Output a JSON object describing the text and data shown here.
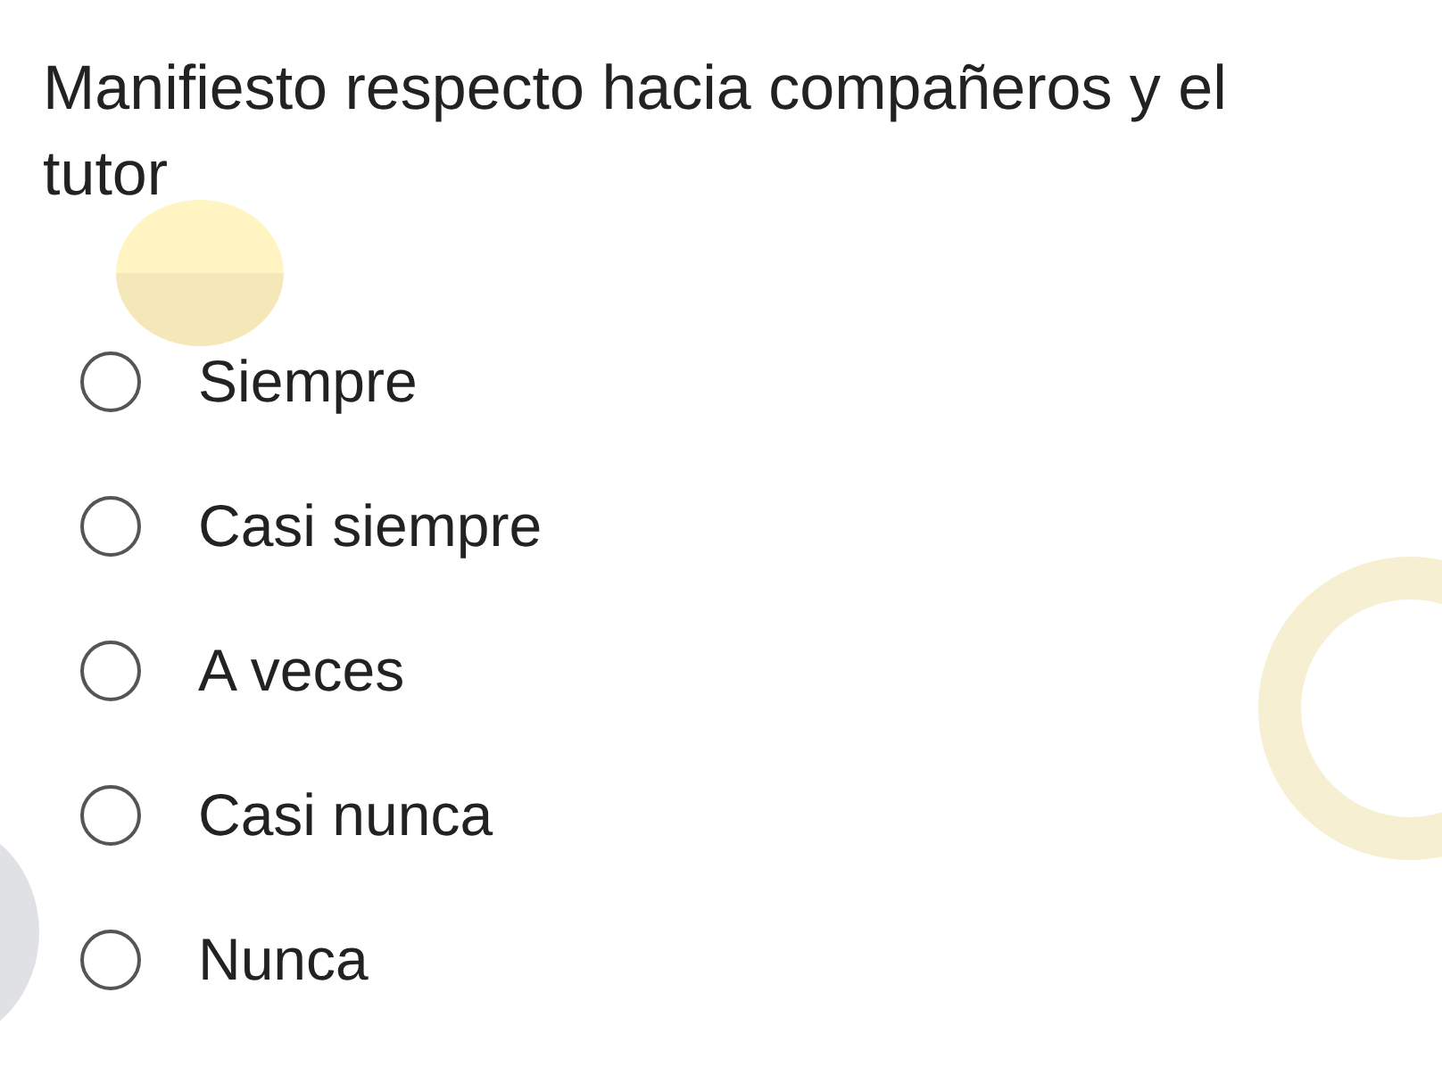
{
  "question": {
    "title": "Manifiesto respecto hacia compañeros y el tutor"
  },
  "options": [
    {
      "label": "Siempre",
      "selected": false
    },
    {
      "label": "Casi siempre",
      "selected": false
    },
    {
      "label": "A veces",
      "selected": false
    },
    {
      "label": "Casi nunca",
      "selected": false
    },
    {
      "label": "Nunca",
      "selected": false
    }
  ]
}
